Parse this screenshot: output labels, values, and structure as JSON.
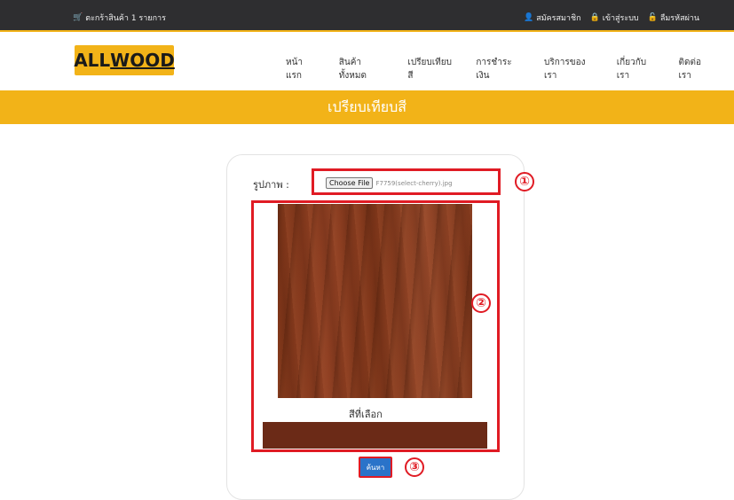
{
  "topbar": {
    "cart_text": "ตะกร้าสินค้า 1 รายการ",
    "register": "สมัครสมาชิก",
    "login": "เข้าสู่ระบบ",
    "forgot": "ลืมรหัสผ่าน"
  },
  "logo": {
    "part1": "ALL",
    "part2": "WOOD"
  },
  "nav": [
    "หน้าแรก",
    "สินค้าทั้งหมด",
    "เปรียบเทียบสี",
    "การชำระเงิน",
    "บริการของเรา",
    "เกี่ยวกับเรา",
    "ติดต่อเรา"
  ],
  "banner": {
    "title": "เปรียบเทียบสี"
  },
  "form": {
    "picture_label": "รูปภาพ :",
    "choose_file": "Choose File",
    "file_name": "F7759(select-cherry).jpg",
    "chosen_label": "สีที่เลือก",
    "search_button": "ค้นหา"
  },
  "annotations": [
    "①",
    "②",
    "③"
  ],
  "colors": {
    "accent": "#f2b318",
    "topbar": "#2e2e30",
    "chosen_color": "#6b2a17",
    "annotation": "#e01b24",
    "button": "#2a73c9"
  }
}
